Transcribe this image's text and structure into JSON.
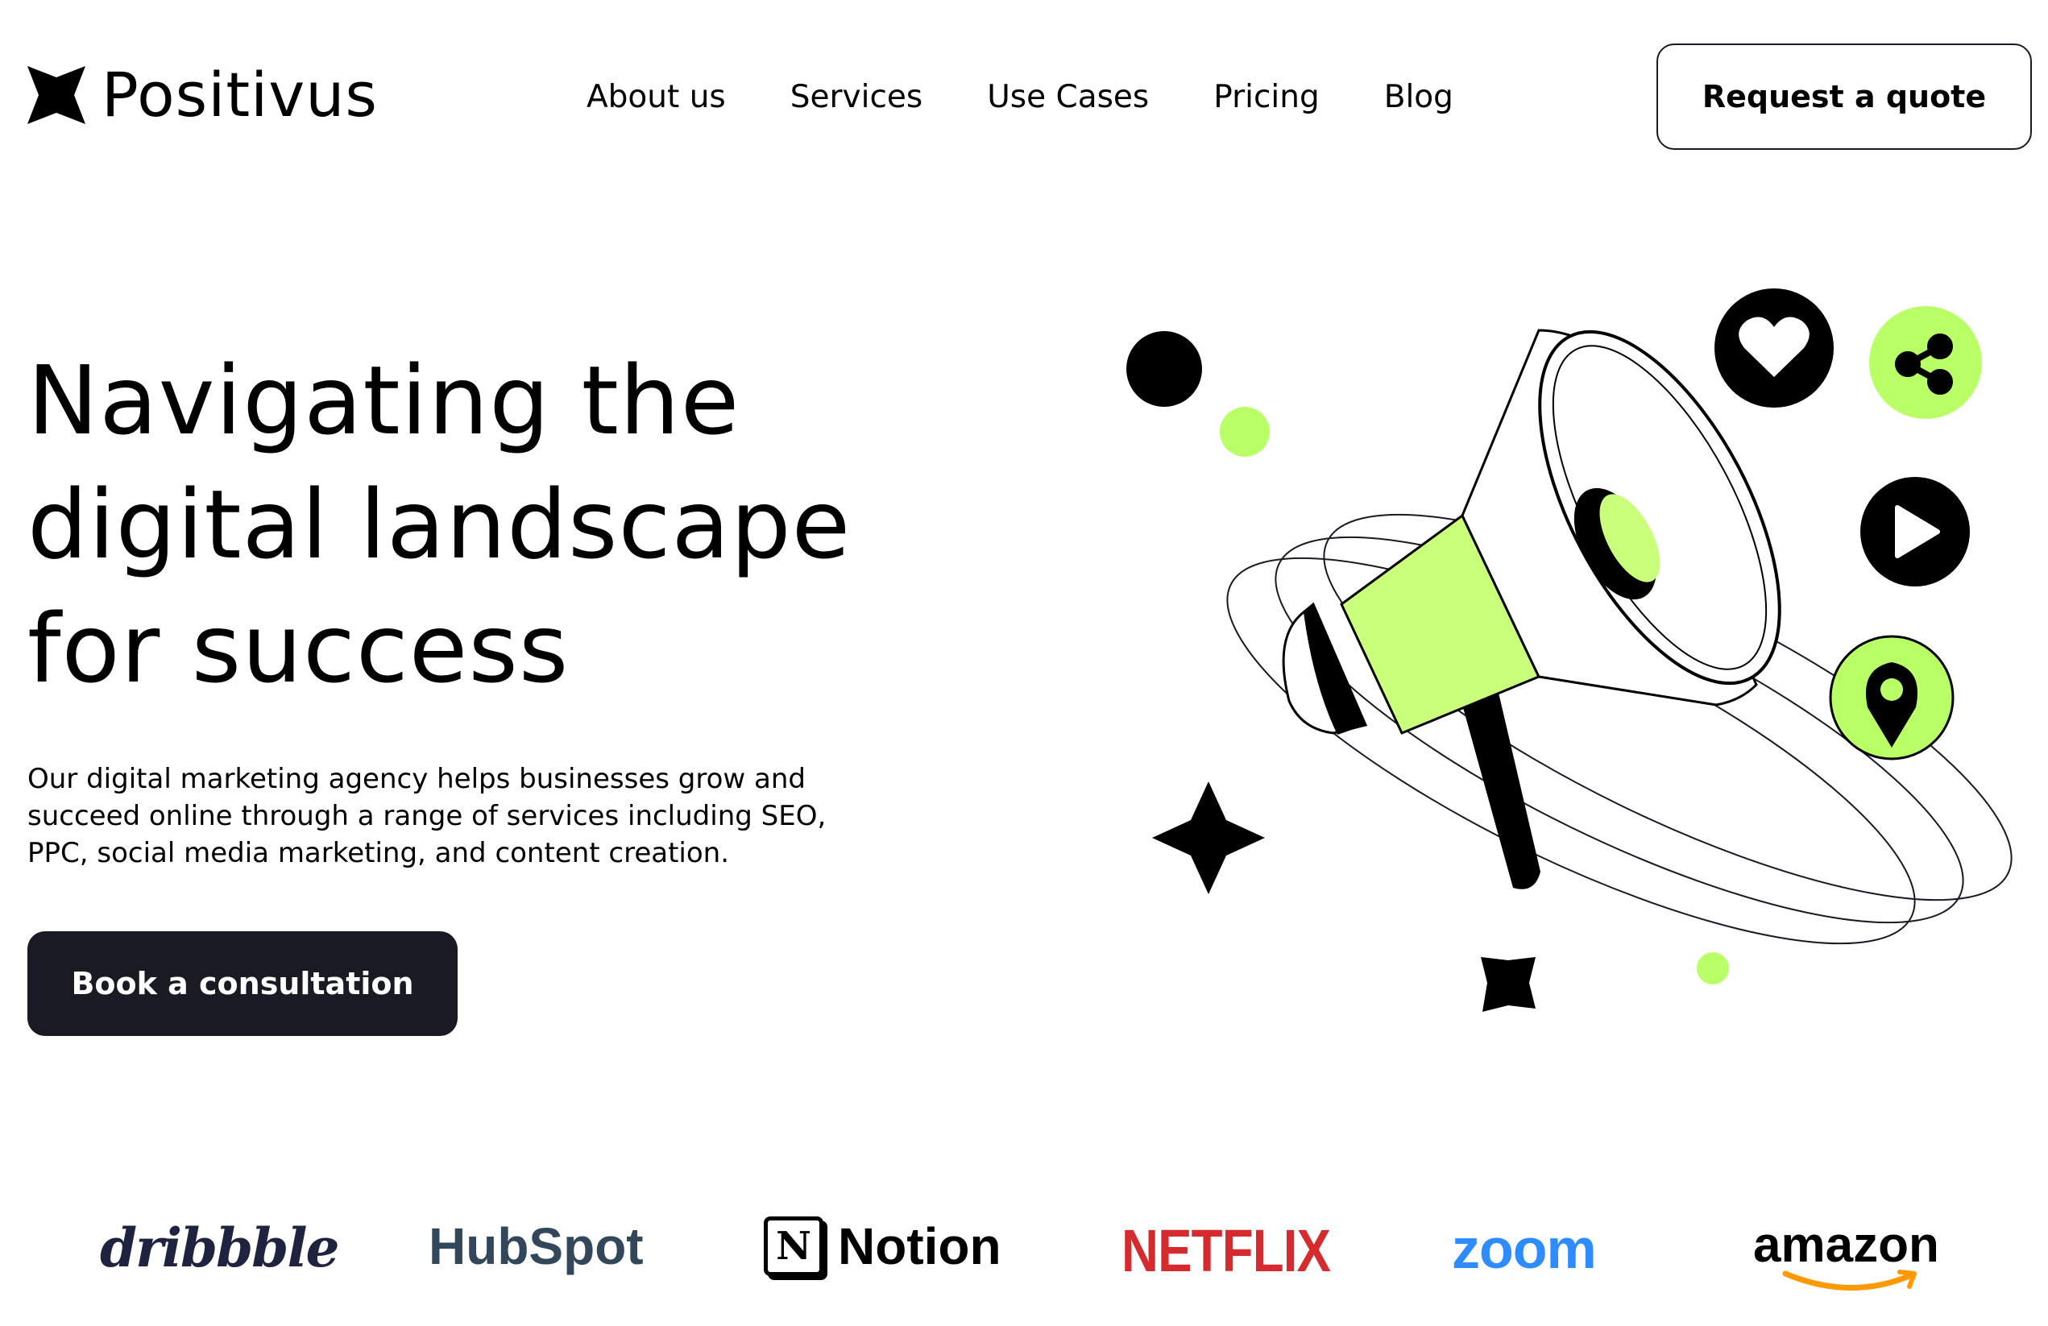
{
  "brand": {
    "name": "Positivus",
    "logo_icon": "four-point-star-icon"
  },
  "nav": {
    "items": [
      {
        "label": "About us"
      },
      {
        "label": "Services"
      },
      {
        "label": "Use Cases"
      },
      {
        "label": "Pricing"
      },
      {
        "label": "Blog"
      }
    ],
    "cta_label": "Request a quote"
  },
  "hero": {
    "title_lines": [
      "Navigating the",
      "digital landscape",
      "for success"
    ],
    "description_lines": [
      "Our digital marketing agency helps businesses grow and",
      "succeed online through a range of services including SEO,",
      "PPC, social media marketing, and content creation."
    ],
    "cta_label": "Book a consultation",
    "illustration_icons": [
      "megaphone-icon",
      "heart-icon",
      "share-icon",
      "play-icon",
      "location-pin-icon",
      "star-icon"
    ]
  },
  "clients": {
    "logos": [
      {
        "name": "dribbble"
      },
      {
        "name": "HubSpot"
      },
      {
        "name": "Notion"
      },
      {
        "name": "NETFLIX"
      },
      {
        "name": "zoom"
      },
      {
        "name": "amazon"
      }
    ]
  },
  "colors": {
    "accent": "#b9ff66",
    "dark": "#191a23",
    "background": "#ffffff",
    "netflix": "#d52b2e",
    "zoom": "#2d8cff",
    "hubspot": "#33475b",
    "hubspot_accent": "#ff7a59",
    "amazon_smile": "#ff9900"
  }
}
